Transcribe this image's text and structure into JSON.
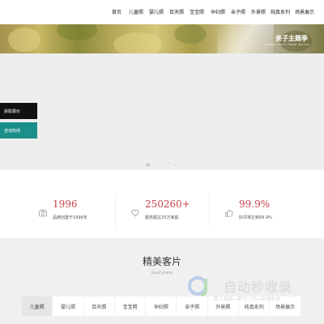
{
  "nav": {
    "items": [
      "首页",
      "儿童照",
      "婴儿照",
      "百天照",
      "宝宝照",
      "孕妇照",
      "亲子照",
      "外景照",
      "纯真系列",
      "场景展示"
    ]
  },
  "hero": {
    "caption": "亲子主题季",
    "subcaption": "PARENT-CHILD THEME SEASON"
  },
  "side_buttons": {
    "price_label": "获取报价",
    "consult_label": "咨询热线"
  },
  "slider": {
    "count": 5,
    "active_index": 0
  },
  "stats": [
    {
      "icon": "camera-icon",
      "number": "1996",
      "desc": "品牌创建于1996年"
    },
    {
      "icon": "heart-icon",
      "number": "250260+",
      "desc": "服务超过25万家庭"
    },
    {
      "icon": "thumbs-up-icon",
      "number": "99.9%",
      "desc": "好评率达到99.9%"
    }
  ],
  "gallery": {
    "title": "精美客片",
    "subtitle": "Guest photos",
    "tabs": [
      "儿童照",
      "婴儿照",
      "百天照",
      "宝宝照",
      "孕妇照",
      "亲子照",
      "外景照",
      "纯真系列",
      "场景展示"
    ],
    "active_tab": 0
  },
  "watermark": {
    "text": "自动秒收录",
    "tagline": "数上链接→来访一次→自动收录"
  },
  "colors": {
    "accent_red": "#c7454d",
    "teal": "#1b8f8a",
    "dark": "#111111"
  }
}
